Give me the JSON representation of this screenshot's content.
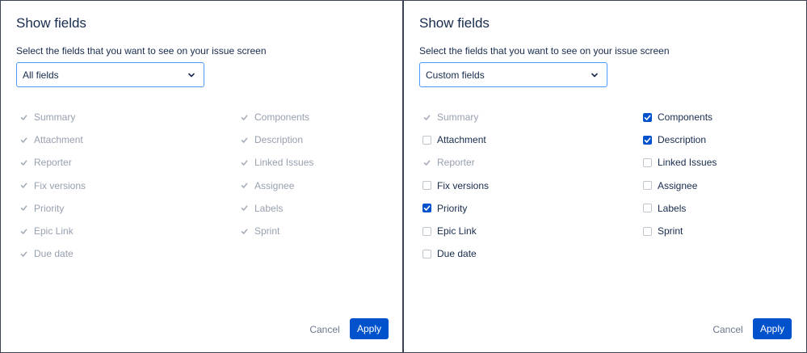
{
  "colors": {
    "primary": "#0052cc",
    "text": "#172b4d",
    "disabled": "#97a0af",
    "focus_border": "#4c9aff"
  },
  "panels": [
    {
      "title": "Show fields",
      "prompt": "Select the fields that you want to see on your issue screen",
      "select_value": "All fields",
      "cancel_label": "Cancel",
      "apply_label": "Apply",
      "columns": [
        [
          {
            "label": "Summary",
            "state": "disabled"
          },
          {
            "label": "Attachment",
            "state": "disabled"
          },
          {
            "label": "Reporter",
            "state": "disabled"
          },
          {
            "label": "Fix versions",
            "state": "disabled"
          },
          {
            "label": "Priority",
            "state": "disabled"
          },
          {
            "label": "Epic Link",
            "state": "disabled"
          },
          {
            "label": "Due date",
            "state": "disabled"
          }
        ],
        [
          {
            "label": "Components",
            "state": "disabled"
          },
          {
            "label": "Description",
            "state": "disabled"
          },
          {
            "label": "Linked Issues",
            "state": "disabled"
          },
          {
            "label": "Assignee",
            "state": "disabled"
          },
          {
            "label": "Labels",
            "state": "disabled"
          },
          {
            "label": "Sprint",
            "state": "disabled"
          }
        ]
      ]
    },
    {
      "title": "Show fields",
      "prompt": "Select the fields that you want to see on your issue screen",
      "select_value": "Custom fields",
      "cancel_label": "Cancel",
      "apply_label": "Apply",
      "columns": [
        [
          {
            "label": "Summary",
            "state": "disabled"
          },
          {
            "label": "Attachment",
            "state": "unchecked"
          },
          {
            "label": "Reporter",
            "state": "disabled"
          },
          {
            "label": "Fix versions",
            "state": "unchecked"
          },
          {
            "label": "Priority",
            "state": "checked"
          },
          {
            "label": "Epic Link",
            "state": "unchecked"
          },
          {
            "label": "Due date",
            "state": "unchecked"
          }
        ],
        [
          {
            "label": "Components",
            "state": "checked"
          },
          {
            "label": "Description",
            "state": "checked"
          },
          {
            "label": "Linked Issues",
            "state": "unchecked"
          },
          {
            "label": "Assignee",
            "state": "unchecked"
          },
          {
            "label": "Labels",
            "state": "unchecked"
          },
          {
            "label": "Sprint",
            "state": "unchecked"
          }
        ]
      ]
    }
  ]
}
